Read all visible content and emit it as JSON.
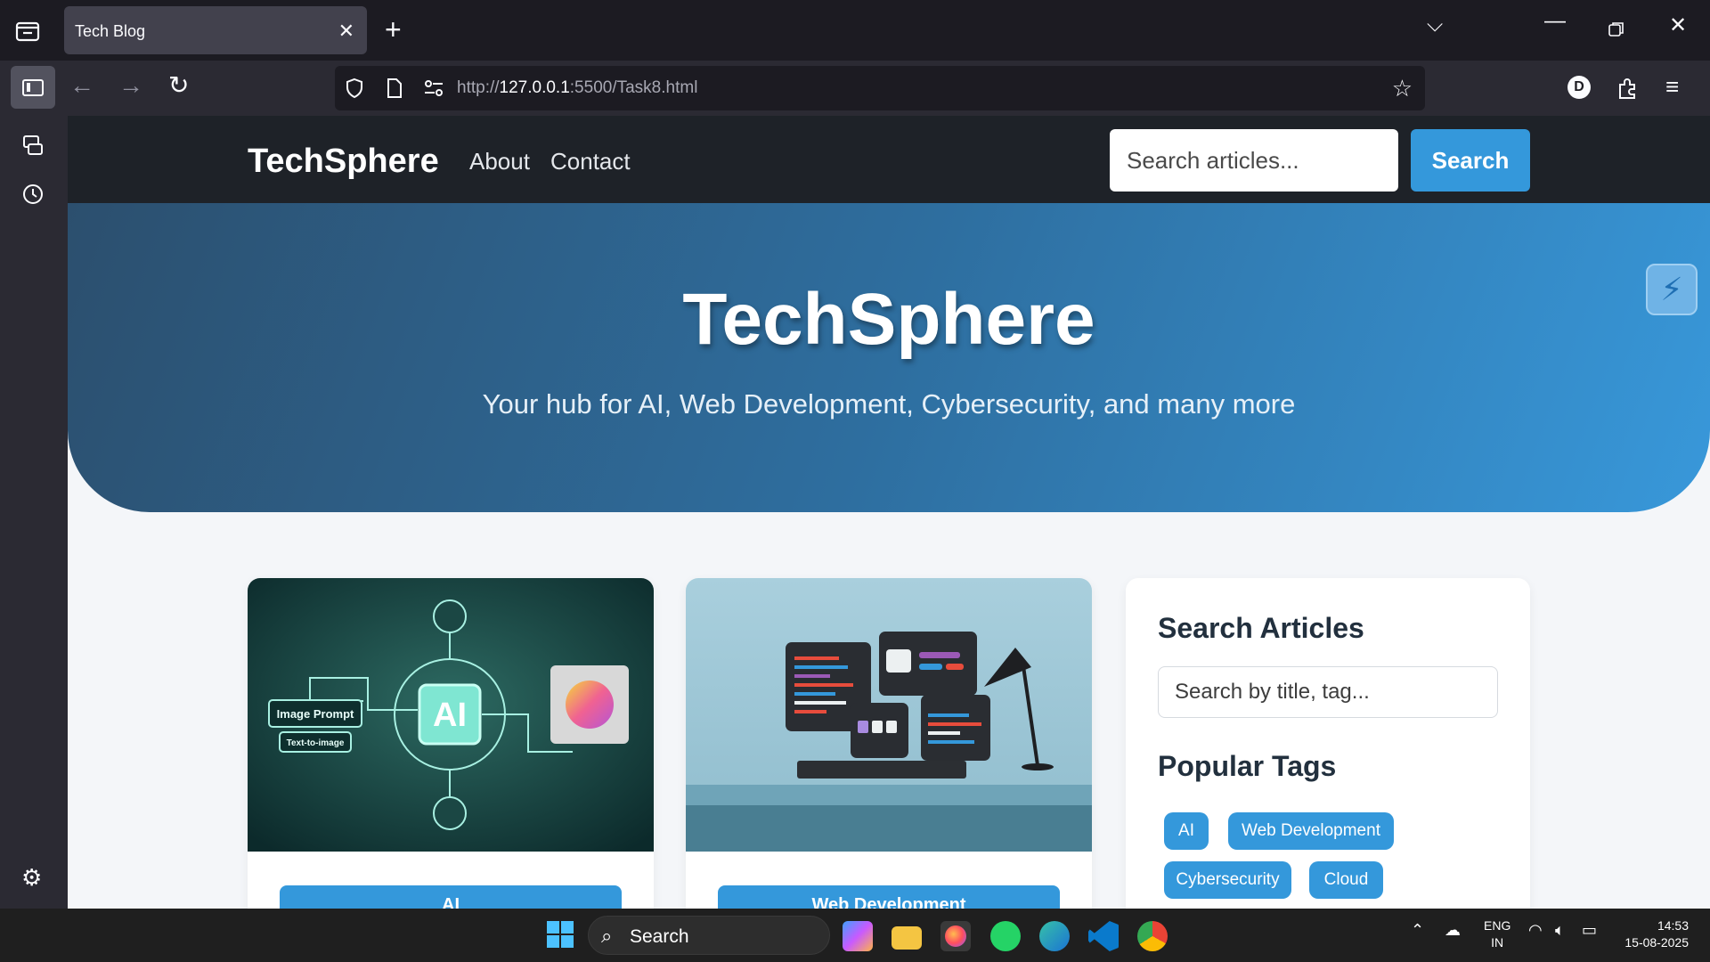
{
  "browser": {
    "tab_title": "Tech Blog",
    "url_host": "127.0.0.1",
    "url_prefix": "http://",
    "url_rest": ":5500/Task8.html",
    "profile_initial": "D"
  },
  "site": {
    "logo": "TechSphere",
    "nav": [
      "About",
      "Contact"
    ],
    "search_placeholder": "Search articles...",
    "search_button": "Search"
  },
  "hero": {
    "title": "TechSphere",
    "subtitle": "Your hub for AI, Web Development, Cybersecurity, and many more"
  },
  "cards": [
    {
      "tag": "AI",
      "image_labels": [
        "Image Prompt",
        "Text-to-image",
        "AI"
      ]
    },
    {
      "tag": "Web Development"
    }
  ],
  "sidebar_panel": {
    "search_heading": "Search Articles",
    "search_placeholder": "Search by title, tag...",
    "tags_heading": "Popular Tags",
    "tags": [
      "AI",
      "Web Development",
      "Cybersecurity",
      "Cloud"
    ]
  },
  "taskbar": {
    "search_label": "Search",
    "lang_line1": "ENG",
    "lang_line2": "IN",
    "time": "14:53",
    "date": "15-08-2025"
  },
  "colors": {
    "accent": "#3498db",
    "header_bg": "#1e2228",
    "hero_start": "#2c4f6e",
    "hero_end": "#3898da"
  }
}
